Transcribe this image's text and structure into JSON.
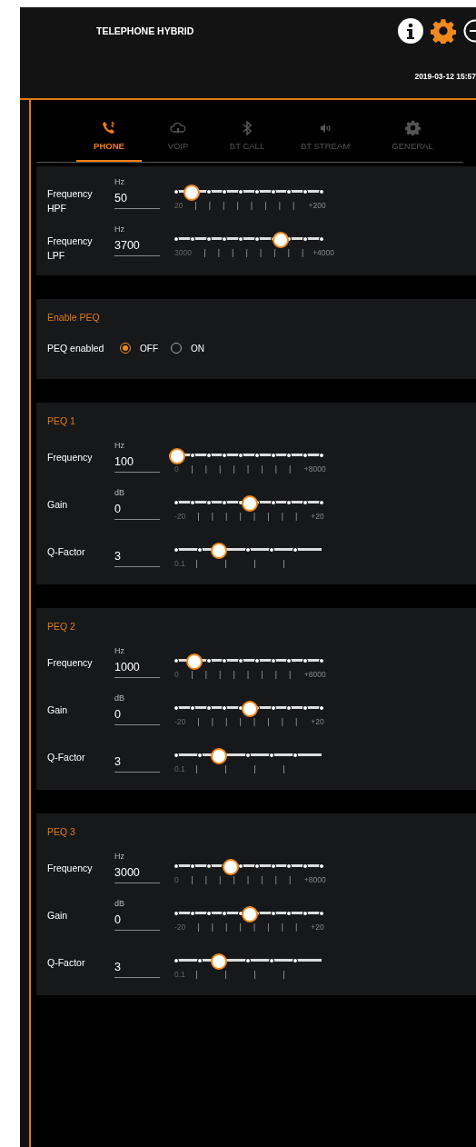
{
  "header": {
    "title": "TELEPHONE HYBRID",
    "datetime": "2019-03-12 15:57"
  },
  "tabs": [
    {
      "label": "PHONE",
      "selected": true
    },
    {
      "label": "VOIP",
      "selected": false
    },
    {
      "label": "BT CALL",
      "selected": false
    },
    {
      "label": "BT STREAM",
      "selected": false
    },
    {
      "label": "GENERAL",
      "selected": false
    }
  ],
  "sections": [
    {
      "kind": "sliders",
      "rows": [
        {
          "kind": "scale",
          "label": "Frequency HPF",
          "unit": "Hz",
          "value": "50",
          "min_label": "20",
          "max_label": "+200",
          "level": 0.1
        },
        {
          "kind": "scale",
          "label": "Frequency LPF",
          "unit": "Hz",
          "value": "3700",
          "min_label": "3000",
          "max_label": "+4000",
          "level": 0.71
        }
      ]
    },
    {
      "kind": "radio",
      "title": "Enable PEQ",
      "label": "PEQ enabled",
      "options": [
        {
          "label": "OFF",
          "selected": true
        },
        {
          "label": "ON",
          "selected": false
        }
      ]
    },
    {
      "kind": "sliders",
      "title": "PEQ 1",
      "rows": [
        {
          "kind": "scale",
          "label": "Frequency",
          "unit": "Hz",
          "value": "100",
          "min_label": "0",
          "max_label": "+8000",
          "level": 0
        },
        {
          "kind": "scale",
          "label": "Gain",
          "unit": "dB",
          "value": "0",
          "min_label": "-20",
          "max_label": "+20",
          "level": 0.5
        },
        {
          "kind": "q",
          "label": "Q-Factor",
          "value": "3",
          "min_label": "0.1",
          "level": 0.29
        }
      ]
    },
    {
      "kind": "sliders",
      "title": "PEQ 2",
      "rows": [
        {
          "kind": "scale",
          "label": "Frequency",
          "unit": "Hz",
          "value": "1000",
          "min_label": "0",
          "max_label": "+8000",
          "level": 0.12
        },
        {
          "kind": "scale",
          "label": "Gain",
          "unit": "dB",
          "value": "0",
          "min_label": "-20",
          "max_label": "+20",
          "level": 0.5
        },
        {
          "kind": "q",
          "label": "Q-Factor",
          "value": "3",
          "min_label": "0.1",
          "level": 0.29
        }
      ]
    },
    {
      "kind": "sliders",
      "title": "PEQ 3",
      "rows": [
        {
          "kind": "scale",
          "label": "Frequency",
          "unit": "Hz",
          "value": "3000",
          "min_label": "0",
          "max_label": "+8000",
          "level": 0.37
        },
        {
          "kind": "scale",
          "label": "Gain",
          "unit": "dB",
          "value": "0",
          "min_label": "-20",
          "max_label": "+20",
          "level": 0.5
        },
        {
          "kind": "q",
          "label": "Q-Factor",
          "value": "3",
          "min_label": "0.1",
          "level": 0.29
        }
      ]
    }
  ]
}
